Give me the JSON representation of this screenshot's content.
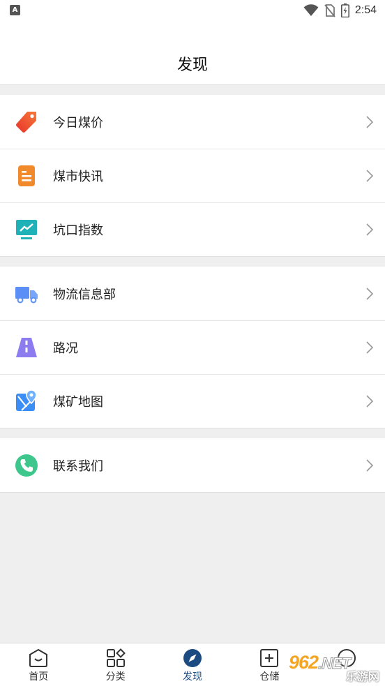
{
  "status_bar": {
    "notification_badge": "A",
    "time": "2:54"
  },
  "header": {
    "title": "发现"
  },
  "menu": {
    "group1": [
      {
        "label": "今日煤价",
        "icon": "price-tag-icon"
      },
      {
        "label": "煤市快讯",
        "icon": "news-doc-icon"
      },
      {
        "label": "坑口指数",
        "icon": "trend-monitor-icon"
      }
    ],
    "group2": [
      {
        "label": "物流信息部",
        "icon": "truck-icon"
      },
      {
        "label": "路况",
        "icon": "road-icon"
      },
      {
        "label": "煤矿地图",
        "icon": "map-pin-icon"
      }
    ],
    "group3": [
      {
        "label": "联系我们",
        "icon": "phone-icon"
      }
    ]
  },
  "tab_bar": {
    "tabs": [
      {
        "label": "首页",
        "icon": "home-icon"
      },
      {
        "label": "分类",
        "icon": "category-icon"
      },
      {
        "label": "发现",
        "icon": "compass-icon",
        "active": true
      },
      {
        "label": "仓储",
        "icon": "warehouse-icon"
      },
      {
        "label": "",
        "icon": "profile-icon"
      }
    ]
  },
  "watermark": {
    "brand": "962",
    "suffix": ".NET",
    "sub": "乐游网"
  },
  "colors": {
    "active_tab": "#1c4b82",
    "price_icon": "#f0522a",
    "news_icon": "#f18a2a",
    "trend_icon": "#1eb1b8",
    "truck_icon": "#5b8ff6",
    "road_icon": "#8c7cf0",
    "map_icon": "#3a8ef5",
    "phone_icon": "#3ec78d"
  }
}
